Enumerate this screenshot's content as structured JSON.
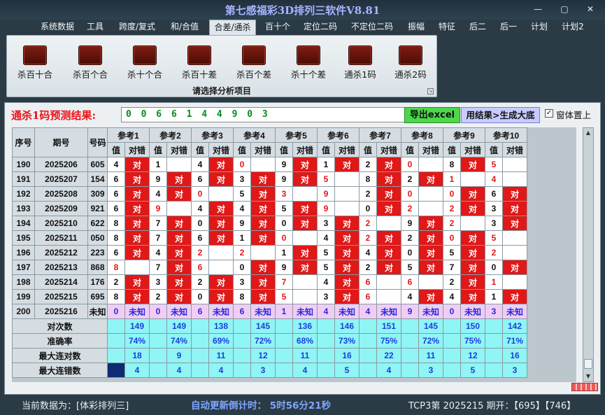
{
  "window": {
    "title": "第七感福彩3D排列三软件V8.81",
    "buttons": [
      {
        "name": "minimize-button",
        "icon": "minimize-icon",
        "glyph": "—"
      },
      {
        "name": "restore-button",
        "icon": "restore-icon",
        "glyph": "▢"
      },
      {
        "name": "close-button",
        "icon": "close-icon",
        "glyph": "✕"
      }
    ]
  },
  "menu": {
    "items": [
      "系统数据",
      "工具",
      "跨度/复式",
      "和/合值",
      "合差/通杀",
      "百十个",
      "定位二码",
      "不定位二码",
      "振幅",
      "特征",
      "后二",
      "后一",
      "计划",
      "计划2"
    ],
    "active": "合差/通杀"
  },
  "ribbon": {
    "tools": [
      {
        "label": "杀百十合",
        "icon": "chart-icon"
      },
      {
        "label": "杀百个合",
        "icon": "chart-icon"
      },
      {
        "label": "杀十个合",
        "icon": "chart-icon"
      },
      {
        "label": "杀百十差",
        "icon": "chart-icon"
      },
      {
        "label": "杀百个差",
        "icon": "chart-icon"
      },
      {
        "label": "杀十个差",
        "icon": "chart-icon"
      },
      {
        "label": "通杀1码",
        "icon": "chart-icon"
      },
      {
        "label": "通杀2码",
        "icon": "chart-icon"
      }
    ],
    "caption": "请选择分析项目"
  },
  "prediction": {
    "label": "通杀1码预测结果:",
    "value": "0 0 6 6 1 4 4 9 0 3",
    "export_label": "导出excel",
    "generate_label": "用结果>生成大底",
    "topmost_label": "窗体置上",
    "topmost_checked": true
  },
  "table": {
    "headers": {
      "seq": "序号",
      "period": "期号",
      "number": "号码",
      "value": "值",
      "result": "对错"
    },
    "refs": [
      "参考1",
      "参考2",
      "参考3",
      "参考4",
      "参考5",
      "参考6",
      "参考7",
      "参考8",
      "参考9",
      "参考10"
    ],
    "hit_text": "对",
    "rows": [
      {
        "seq": "190",
        "period": "2025206",
        "number": "605",
        "vals": [
          "4",
          "1",
          "4",
          "0",
          "9",
          "1",
          "2",
          "0",
          "8",
          "5"
        ],
        "hits": [
          1,
          0,
          1,
          0,
          1,
          1,
          1,
          0,
          1,
          0
        ],
        "red": [
          0,
          0,
          0,
          1,
          0,
          0,
          0,
          1,
          0,
          1
        ]
      },
      {
        "seq": "191",
        "period": "2025207",
        "number": "154",
        "vals": [
          "6",
          "9",
          "6",
          "3",
          "9",
          "5",
          "8",
          "2",
          "1",
          "4"
        ],
        "hits": [
          1,
          1,
          1,
          1,
          1,
          0,
          1,
          1,
          0,
          0
        ],
        "red": [
          0,
          0,
          0,
          0,
          0,
          1,
          0,
          0,
          1,
          1
        ]
      },
      {
        "seq": "192",
        "period": "2025208",
        "number": "309",
        "vals": [
          "6",
          "4",
          "0",
          "5",
          "3",
          "9",
          "2",
          "0",
          "0",
          "6"
        ],
        "hits": [
          1,
          1,
          0,
          1,
          0,
          0,
          1,
          0,
          1,
          1
        ],
        "red": [
          0,
          0,
          1,
          0,
          1,
          1,
          0,
          1,
          1,
          0
        ]
      },
      {
        "seq": "193",
        "period": "2025209",
        "number": "921",
        "vals": [
          "6",
          "9",
          "4",
          "4",
          "5",
          "9",
          "0",
          "2",
          "2",
          "3"
        ],
        "hits": [
          1,
          0,
          1,
          1,
          1,
          0,
          1,
          0,
          1,
          1
        ],
        "red": [
          0,
          1,
          0,
          0,
          0,
          1,
          0,
          1,
          1,
          0
        ]
      },
      {
        "seq": "194",
        "period": "2025210",
        "number": "622",
        "vals": [
          "8",
          "7",
          "0",
          "9",
          "0",
          "3",
          "2",
          "9",
          "2",
          "3"
        ],
        "hits": [
          1,
          1,
          1,
          1,
          1,
          1,
          0,
          1,
          0,
          1
        ],
        "red": [
          0,
          0,
          0,
          0,
          0,
          0,
          1,
          0,
          1,
          0
        ]
      },
      {
        "seq": "195",
        "period": "2025211",
        "number": "050",
        "vals": [
          "8",
          "7",
          "6",
          "1",
          "0",
          "4",
          "2",
          "2",
          "0",
          "5"
        ],
        "hits": [
          1,
          1,
          1,
          1,
          0,
          1,
          1,
          1,
          1,
          0
        ],
        "red": [
          0,
          0,
          0,
          0,
          1,
          0,
          1,
          0,
          1,
          1
        ]
      },
      {
        "seq": "196",
        "period": "2025212",
        "number": "223",
        "vals": [
          "6",
          "4",
          "2",
          "2",
          "1",
          "5",
          "4",
          "0",
          "5",
          "2"
        ],
        "hits": [
          1,
          1,
          0,
          0,
          1,
          1,
          1,
          1,
          1,
          0
        ],
        "red": [
          0,
          0,
          1,
          1,
          0,
          0,
          0,
          0,
          0,
          1
        ]
      },
      {
        "seq": "197",
        "period": "2025213",
        "number": "868",
        "vals": [
          "8",
          "7",
          "6",
          "0",
          "9",
          "5",
          "2",
          "5",
          "7",
          "0"
        ],
        "hits": [
          0,
          1,
          0,
          1,
          1,
          1,
          1,
          1,
          1,
          1
        ],
        "red": [
          1,
          0,
          1,
          0,
          0,
          0,
          0,
          0,
          0,
          0
        ]
      },
      {
        "seq": "198",
        "period": "2025214",
        "number": "176",
        "vals": [
          "2",
          "3",
          "2",
          "3",
          "7",
          "4",
          "6",
          "6",
          "2",
          "1"
        ],
        "hits": [
          1,
          1,
          1,
          1,
          0,
          1,
          0,
          0,
          1,
          0
        ],
        "red": [
          0,
          0,
          0,
          0,
          1,
          0,
          1,
          1,
          0,
          1
        ]
      },
      {
        "seq": "199",
        "period": "2025215",
        "number": "695",
        "vals": [
          "8",
          "2",
          "0",
          "8",
          "5",
          "3",
          "6",
          "4",
          "4",
          "1"
        ],
        "hits": [
          1,
          1,
          1,
          1,
          0,
          1,
          0,
          1,
          1,
          1
        ],
        "red": [
          0,
          0,
          0,
          0,
          1,
          0,
          1,
          0,
          0,
          0
        ]
      }
    ],
    "pending": {
      "seq": "200",
      "period": "2025216",
      "number": "未知",
      "vals": [
        "0",
        "0",
        "6",
        "6",
        "1",
        "4",
        "4",
        "9",
        "0",
        "3"
      ],
      "result": "未知"
    },
    "stats": [
      {
        "label": "对次数",
        "values": [
          "149",
          "149",
          "138",
          "145",
          "136",
          "146",
          "151",
          "145",
          "150",
          "142"
        ]
      },
      {
        "label": "准确率",
        "values": [
          "74%",
          "74%",
          "69%",
          "72%",
          "68%",
          "73%",
          "75%",
          "72%",
          "75%",
          "71%"
        ]
      },
      {
        "label": "最大连对数",
        "values": [
          "18",
          "9",
          "11",
          "12",
          "11",
          "16",
          "22",
          "11",
          "12",
          "16"
        ]
      },
      {
        "label": "最大连错数",
        "values": [
          "4",
          "4",
          "4",
          "3",
          "4",
          "5",
          "4",
          "3",
          "5",
          "3"
        ]
      }
    ]
  },
  "status": {
    "data_source": "当前数据为：[体彩排列三]",
    "countdown": "自动更新倒计时：  5时56分21秒",
    "latest": "TCP3第  2025215 期开：【695】【746】"
  },
  "colors": {
    "hit": "#e01818",
    "stat_bg": "#8ff5f5",
    "pending_bg": "#f1cdf5",
    "accent_title": "#a8b4ff"
  }
}
